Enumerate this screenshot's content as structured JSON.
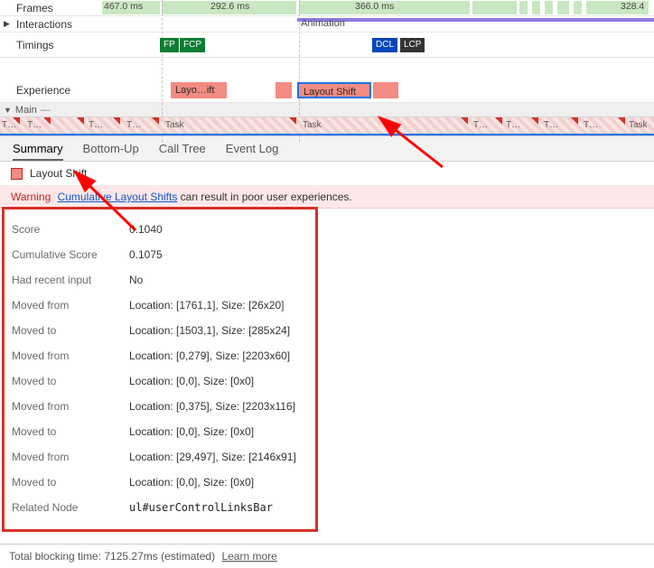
{
  "timeline": {
    "rows": {
      "frames": "Frames",
      "interactions": "Interactions",
      "timings": "Timings",
      "experience": "Experience",
      "main": "Main"
    },
    "frames_ms": [
      "467.0 ms",
      "292.6 ms",
      "366.0 ms",
      "328.4"
    ],
    "animation_label": "Animation",
    "timings_pills": {
      "fp": "FP",
      "fcp": "FCP",
      "dcl": "DCL",
      "lcp": "LCP"
    },
    "experience_items": {
      "first": "Layo…ift",
      "selected": "Layout Shift"
    },
    "task_label": "Task",
    "task_short": "T…",
    "main_dash": "—"
  },
  "tabs": {
    "summary": "Summary",
    "bottom_up": "Bottom-Up",
    "call_tree": "Call Tree",
    "event_log": "Event Log"
  },
  "event_title": "Layout Shift",
  "warning": {
    "label": "Warning",
    "link": "Cumulative Layout Shifts",
    "tail": " can result in poor user experiences."
  },
  "details": [
    {
      "k": "Score",
      "v": "0.1040"
    },
    {
      "k": "Cumulative Score",
      "v": "0.1075"
    },
    {
      "k": "Had recent input",
      "v": "No"
    },
    {
      "k": "Moved from",
      "v": "Location: [1761,1], Size: [26x20]"
    },
    {
      "k": "Moved to",
      "v": "Location: [1503,1], Size: [285x24]"
    },
    {
      "k": "Moved from",
      "v": "Location: [0,279], Size: [2203x60]"
    },
    {
      "k": "Moved to",
      "v": "Location: [0,0], Size: [0x0]"
    },
    {
      "k": "Moved from",
      "v": "Location: [0,375], Size: [2203x116]"
    },
    {
      "k": "Moved to",
      "v": "Location: [0,0], Size: [0x0]"
    },
    {
      "k": "Moved from",
      "v": "Location: [29,497], Size: [2146x91]"
    },
    {
      "k": "Moved to",
      "v": "Location: [0,0], Size: [0x0]"
    },
    {
      "k": "Related Node",
      "v": "ul#userControlLinksBar",
      "mono": true
    }
  ],
  "footer": {
    "text": "Total blocking time: 7125.27ms (estimated)",
    "learn": "Learn more"
  }
}
